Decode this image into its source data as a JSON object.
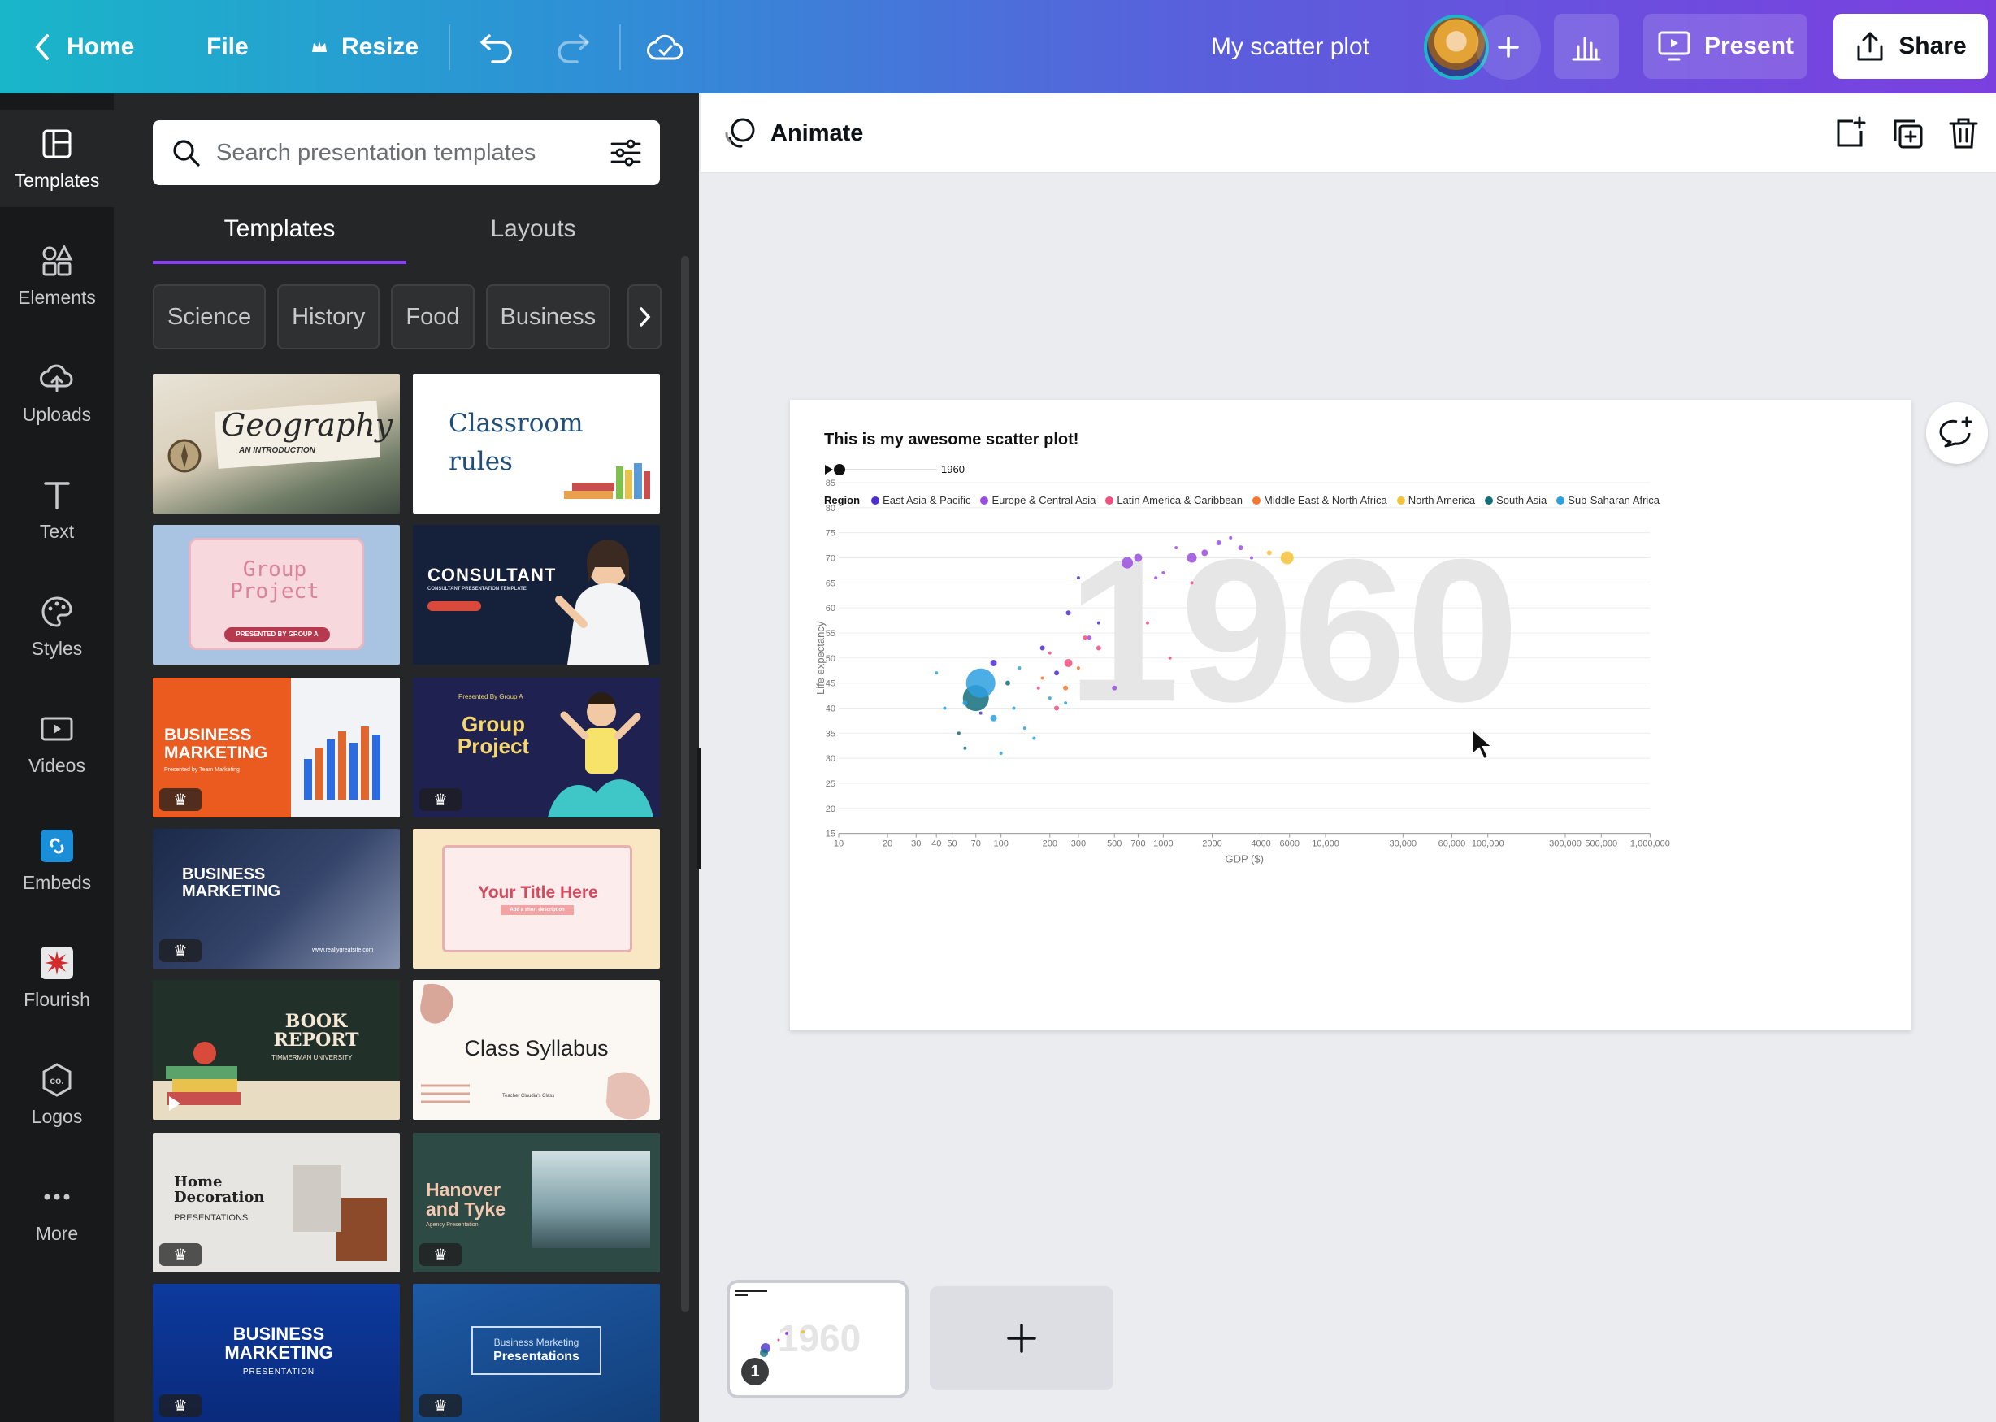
{
  "topbar": {
    "home": "Home",
    "file": "File",
    "resize": "Resize",
    "doc_title": "My scatter plot",
    "present": "Present",
    "share": "Share"
  },
  "rail": {
    "items": [
      {
        "label": "Templates",
        "icon": "templates-icon"
      },
      {
        "label": "Elements",
        "icon": "elements-icon"
      },
      {
        "label": "Uploads",
        "icon": "uploads-icon"
      },
      {
        "label": "Text",
        "icon": "text-icon"
      },
      {
        "label": "Styles",
        "icon": "styles-icon"
      },
      {
        "label": "Videos",
        "icon": "videos-icon"
      },
      {
        "label": "Embeds",
        "icon": "embeds-icon"
      },
      {
        "label": "Flourish",
        "icon": "flourish-icon"
      },
      {
        "label": "Logos",
        "icon": "logos-icon"
      },
      {
        "label": "More",
        "icon": "more-icon"
      }
    ]
  },
  "panel": {
    "search_placeholder": "Search presentation templates",
    "tabs": [
      "Templates",
      "Layouts"
    ],
    "chips": [
      "Science",
      "History",
      "Food",
      "Business"
    ],
    "templates": [
      {
        "title": "Geography",
        "subtitle": "AN INTRODUCTION"
      },
      {
        "title": "Classroom rules"
      },
      {
        "title": "Group Project",
        "subtitle": "PRESENTED BY GROUP A"
      },
      {
        "title": "CONSULTANT",
        "subtitle": "CONSULTANT PRESENTATION TEMPLATE"
      },
      {
        "title": "BUSINESS MARKETING",
        "subtitle": "Presented by Team Marketing"
      },
      {
        "title": "Group Project",
        "subtitle": "Presented By Group A"
      },
      {
        "title": "BUSINESS MARKETING",
        "subtitle": "www.reallygreatsite.com"
      },
      {
        "title": "Your Title Here",
        "subtitle": "Add a short description"
      },
      {
        "title": "BOOK REPORT",
        "subtitle": "TIMMERMAN UNIVERSITY"
      },
      {
        "title": "Class Syllabus",
        "subtitle": "Teacher Claudia's Class"
      },
      {
        "title": "Home Decoration",
        "subtitle": "PRESENTATIONS"
      },
      {
        "title": "Hanover and Tyke",
        "subtitle": "Agency Presentation"
      },
      {
        "title": "BUSINESS MARKETING",
        "subtitle": "PRESENTATION"
      },
      {
        "title": "Presentations",
        "subtitle": "Business Marketing"
      }
    ]
  },
  "editor": {
    "animate_label": "Animate",
    "page_number": "1"
  },
  "chart_data": {
    "type": "scatter",
    "title": "This is my awesome scatter plot!",
    "year": "1960",
    "legend_title": "Region",
    "xlabel": "GDP ($)",
    "ylabel": "Life expectancy",
    "x_scale": "log",
    "x_ticks": [
      "10",
      "20",
      "30",
      "40",
      "50",
      "70",
      "100",
      "200",
      "300",
      "500",
      "700",
      "1000",
      "2000",
      "4000",
      "6000",
      "10,000",
      "30,000",
      "60,000",
      "100,000",
      "300,000",
      "500,000",
      "1,000,000"
    ],
    "x_tick_values": [
      10,
      20,
      30,
      40,
      50,
      70,
      100,
      200,
      300,
      500,
      700,
      1000,
      2000,
      4000,
      6000,
      10000,
      30000,
      60000,
      100000,
      300000,
      500000,
      1000000
    ],
    "y_ticks": [
      15,
      20,
      25,
      30,
      35,
      40,
      45,
      50,
      55,
      60,
      65,
      70,
      75,
      80,
      85
    ],
    "ylim": [
      15,
      85
    ],
    "xlim": [
      10,
      1000000
    ],
    "grid": true,
    "legend_position": "top-left",
    "series": [
      {
        "name": "East Asia & Pacific",
        "color": "#4d2fd0",
        "points": [
          [
            90,
            49,
            4
          ],
          [
            180,
            52,
            3
          ],
          [
            220,
            47,
            3
          ],
          [
            400,
            57,
            2
          ],
          [
            300,
            66,
            2
          ],
          [
            260,
            59,
            3
          ],
          [
            75,
            39,
            2
          ]
        ]
      },
      {
        "name": "Europe & Central Asia",
        "color": "#9b4de0",
        "points": [
          [
            700,
            70,
            5
          ],
          [
            600,
            69,
            7
          ],
          [
            1500,
            70,
            6
          ],
          [
            1800,
            71,
            4
          ],
          [
            2200,
            73,
            3
          ],
          [
            3000,
            72,
            3
          ],
          [
            1200,
            72,
            2
          ],
          [
            900,
            66,
            2
          ],
          [
            2600,
            74,
            2
          ],
          [
            3500,
            70,
            2
          ],
          [
            500,
            44,
            3
          ],
          [
            350,
            54,
            3
          ],
          [
            1000,
            67,
            2
          ]
        ]
      },
      {
        "name": "Latin America & Caribbean",
        "color": "#f04e7e",
        "points": [
          [
            260,
            49,
            5
          ],
          [
            400,
            52,
            3
          ],
          [
            330,
            54,
            3
          ],
          [
            220,
            40,
            3
          ],
          [
            800,
            57,
            2
          ],
          [
            1500,
            65,
            2
          ],
          [
            1100,
            50,
            2
          ],
          [
            170,
            44,
            2
          ],
          [
            200,
            51,
            2
          ]
        ]
      },
      {
        "name": "Middle East & North Africa",
        "color": "#f5782c",
        "points": [
          [
            250,
            44,
            3
          ],
          [
            180,
            46,
            2
          ],
          [
            300,
            48,
            2
          ]
        ]
      },
      {
        "name": "North America",
        "color": "#f5c33a",
        "points": [
          [
            5800,
            70,
            8
          ],
          [
            4500,
            71,
            3
          ]
        ]
      },
      {
        "name": "South Asia",
        "color": "#136f7c",
        "points": [
          [
            70,
            42,
            16
          ],
          [
            110,
            45,
            3
          ],
          [
            55,
            35,
            2
          ],
          [
            60,
            32,
            2
          ]
        ]
      },
      {
        "name": "Sub-Saharan Africa",
        "color": "#2e9fe0",
        "points": [
          [
            75,
            45,
            18
          ],
          [
            90,
            38,
            4
          ],
          [
            60,
            41,
            3
          ],
          [
            120,
            40,
            2
          ],
          [
            45,
            40,
            2
          ],
          [
            140,
            36,
            2
          ],
          [
            100,
            31,
            2
          ],
          [
            130,
            48,
            2
          ],
          [
            200,
            42,
            2
          ],
          [
            40,
            47,
            2
          ],
          [
            160,
            34,
            2
          ],
          [
            250,
            41,
            2
          ]
        ]
      }
    ]
  }
}
